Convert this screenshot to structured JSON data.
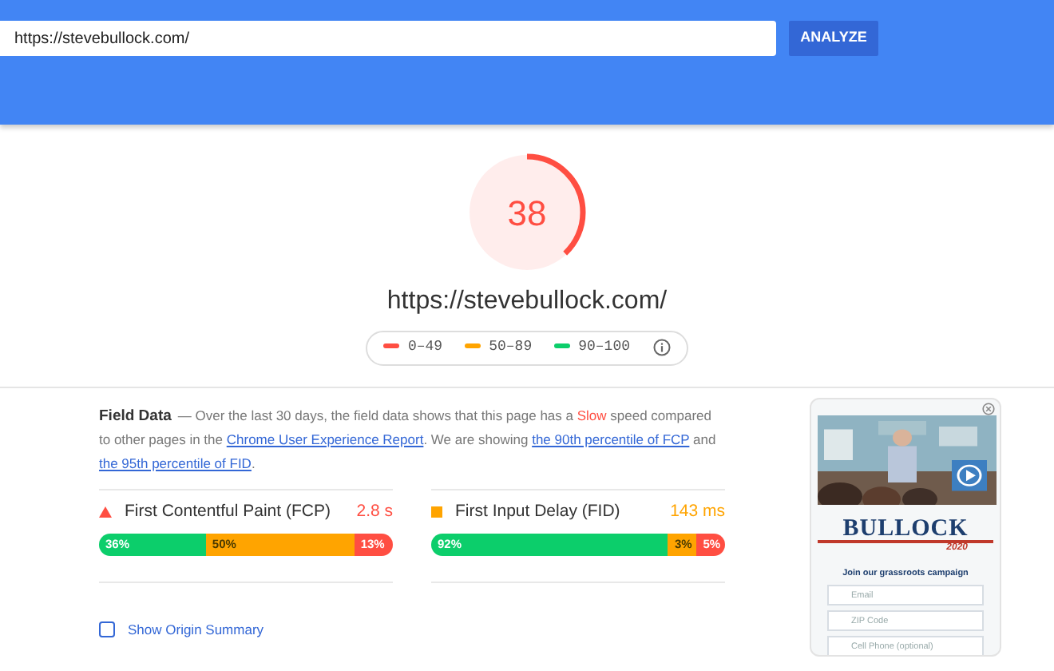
{
  "search": {
    "value": "https://stevebullock.com/",
    "button": "ANALYZE"
  },
  "score": {
    "value": "38",
    "level": 0.38,
    "color": "#ff4e42"
  },
  "url": "https://stevebullock.com/",
  "legend": [
    {
      "label": "0–49",
      "color": "#ff4e42"
    },
    {
      "label": "50–89",
      "color": "#ffa400"
    },
    {
      "label": "90–100",
      "color": "#0cce6b"
    }
  ],
  "field_data": {
    "title": "Field Data",
    "description": [
      {
        "kind": "plain",
        "text": "— Over the last 30 days, the field data shows that this page has a "
      },
      {
        "kind": "slow",
        "text": "Slow"
      },
      {
        "kind": "plain",
        "text": " speed compared to other pages in the "
      },
      {
        "kind": "link",
        "text": "Chrome User Experience Report"
      },
      {
        "kind": "plain",
        "text": ". We are showing "
      },
      {
        "kind": "link",
        "text": "the 90th percentile of FCP"
      },
      {
        "kind": "plain",
        "text": " and "
      },
      {
        "kind": "link",
        "text": "the 95th percentile of FID"
      },
      {
        "kind": "plain",
        "text": "."
      }
    ],
    "metrics": [
      {
        "name": "First Contentful Paint (FCP)",
        "value": "2.8 s",
        "kind": "triangle",
        "color": "#ff4e42",
        "segments": [
          {
            "label": "36%",
            "color": "#0cce6b"
          },
          {
            "label": "50%",
            "color": "#ffa400"
          },
          {
            "label": "13%",
            "color": "#ff4e42"
          }
        ]
      },
      {
        "name": "First Input Delay (FID)",
        "value": "143 ms",
        "kind": "square",
        "color": "#ffa400",
        "segments": [
          {
            "label": "92%",
            "color": "#0cce6b"
          },
          {
            "label": "3%",
            "color": "#ffa400"
          },
          {
            "label": "5%",
            "color": "#ff4e42"
          }
        ]
      }
    ],
    "origin_summary": {
      "label": "Show Origin Summary",
      "checked": false
    }
  },
  "thumbnail": {
    "logo": "BULLOCK",
    "logo_year": "2020",
    "form_title": "Join our grassroots campaign",
    "fields": [
      "Email",
      "ZIP Code",
      "Cell Phone (optional)"
    ]
  }
}
